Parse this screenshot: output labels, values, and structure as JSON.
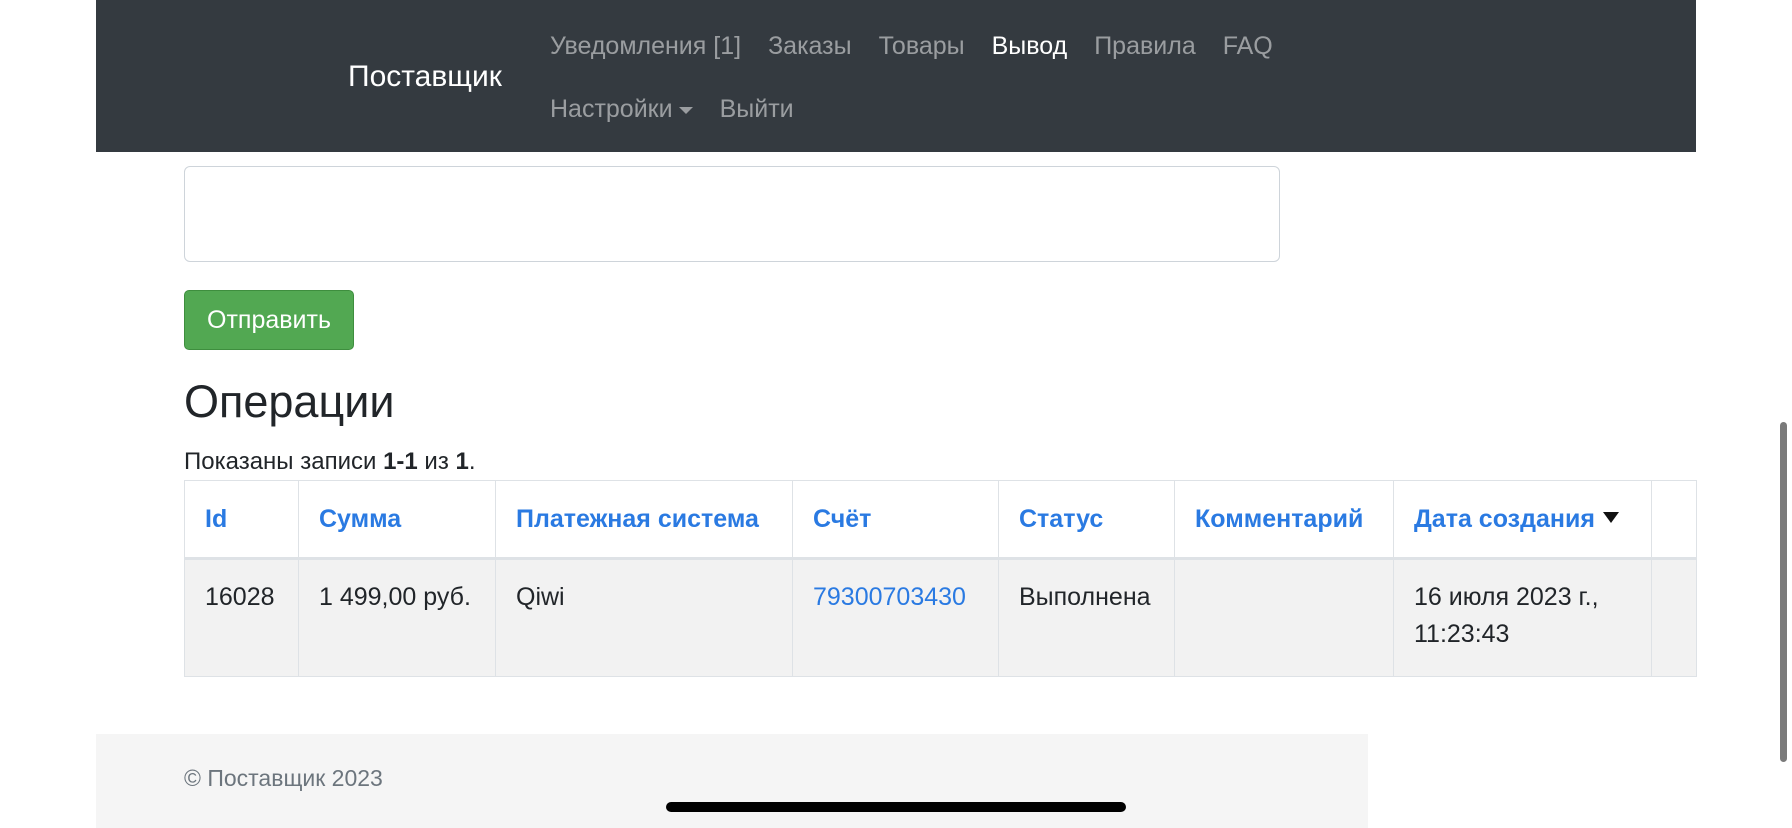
{
  "navbar": {
    "brand": "Поставщик",
    "row1": [
      {
        "label": "Уведомления [1]",
        "active": false
      },
      {
        "label": "Заказы",
        "active": false
      },
      {
        "label": "Товары",
        "active": false
      },
      {
        "label": "Вывод",
        "active": true
      },
      {
        "label": "Правила",
        "active": false
      },
      {
        "label": "FAQ",
        "active": false
      }
    ],
    "row2": [
      {
        "label": "Настройки",
        "active": false,
        "dropdown": true
      },
      {
        "label": "Выйти",
        "active": false
      }
    ]
  },
  "form": {
    "textarea_value": "",
    "submit_label": "Отправить"
  },
  "operations": {
    "title": "Операции",
    "summary": {
      "prefix": "Показаны записи ",
      "range": "1-1",
      "middle": " из ",
      "total": "1",
      "suffix": "."
    },
    "columns": [
      {
        "label": "Id",
        "sorted": false
      },
      {
        "label": "Сумма",
        "sorted": false
      },
      {
        "label": "Платежная система",
        "sorted": false
      },
      {
        "label": "Счёт",
        "sorted": false
      },
      {
        "label": "Статус",
        "sorted": false
      },
      {
        "label": "Комментарий",
        "sorted": false
      },
      {
        "label": "Дата создания",
        "sorted": true,
        "sort_icon": "sort-desc-icon"
      },
      {
        "label": "",
        "sorted": false
      }
    ],
    "rows": [
      {
        "id": "16028",
        "amount": "1 499,00 руб.",
        "payment_system": "Qiwi",
        "account": "79300703430",
        "status": "Выполнена",
        "comment": "",
        "created_line1": "16 июля 2023 г.,",
        "created_line2": "11:23:43",
        "extra": ""
      }
    ]
  },
  "footer": {
    "text": "© Поставщик 2023"
  },
  "colors": {
    "navbar_bg": "#343a40",
    "link": "#2a7ae2",
    "submit_bg": "#52a852",
    "row_bg": "#f2f2f2"
  }
}
